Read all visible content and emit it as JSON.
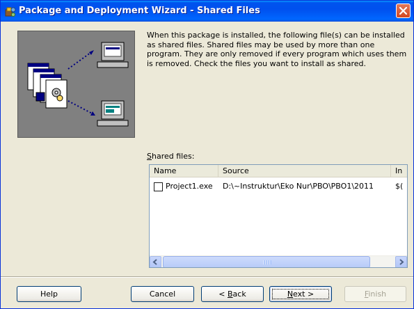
{
  "window": {
    "title": "Package and Deployment Wizard - Shared Files"
  },
  "description": "When this package is installed, the following file(s) can be installed as shared files. Shared files may be used by more than one program. They are only removed if every program which uses them is removed. Check the files you want to install as shared.",
  "shared_files": {
    "label_accel": "S",
    "label_rest": "hared files:",
    "columns": [
      "Name",
      "Source",
      "In"
    ],
    "rows": [
      {
        "checked": false,
        "name": "Project1.exe",
        "source": "D:\\~Instruktur\\Eko Nur\\PBO\\PBO1\\2011",
        "install": "$("
      }
    ],
    "scroll_thumb_glyph": "III"
  },
  "buttons": {
    "help": "Help",
    "cancel": "Cancel",
    "back_pre": "< ",
    "back_accel": "B",
    "back_rest": "ack",
    "next_accel": "N",
    "next_rest": "ext >",
    "finish_accel": "F",
    "finish_rest": "inish"
  },
  "icons": {
    "title": "package-wizard-icon",
    "close": "close-icon",
    "art": "deployment-illustration-icon"
  },
  "colors": {
    "titlebar": "#0054e3",
    "face": "#ece9d8",
    "close": "#d4471f"
  }
}
